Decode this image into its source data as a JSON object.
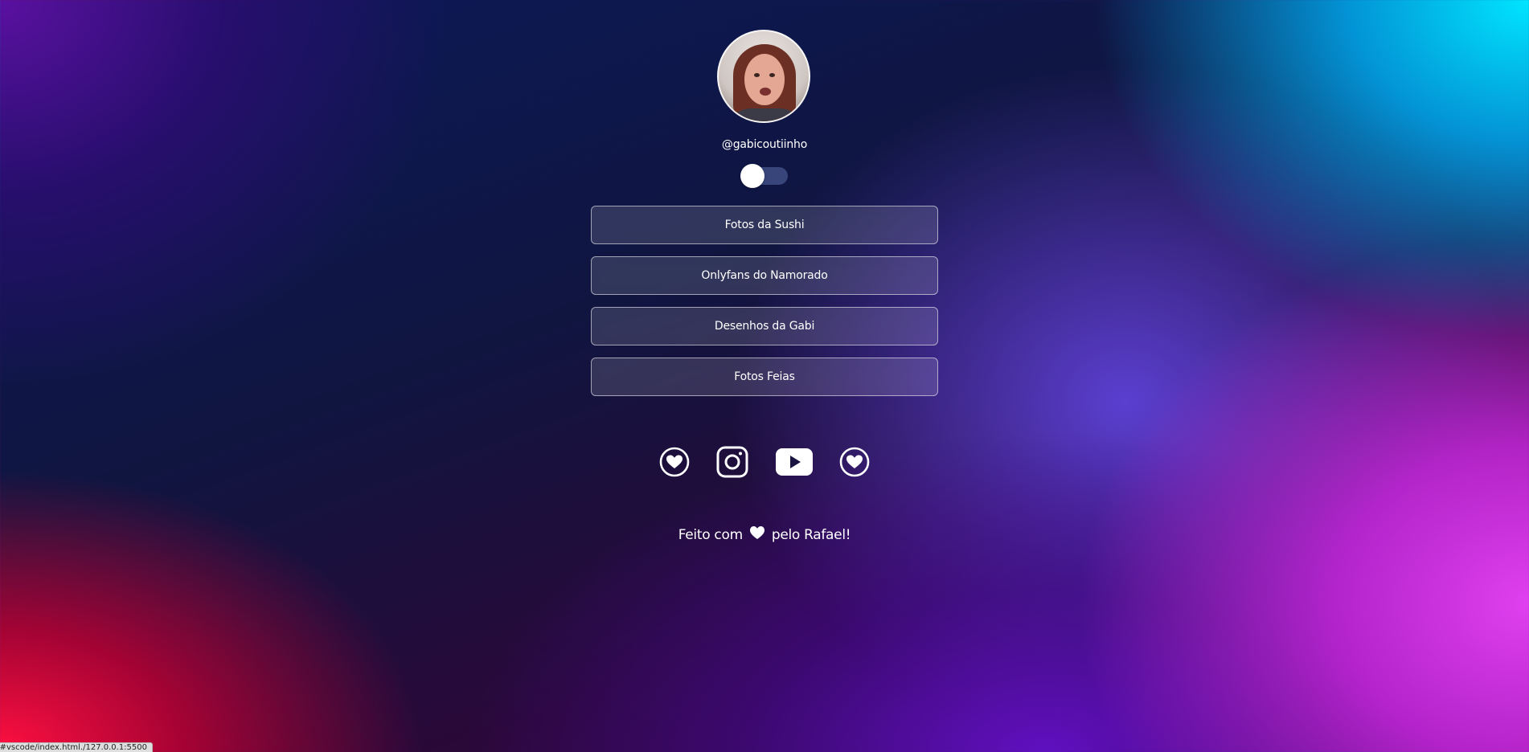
{
  "profile": {
    "handle": "@gabicoutiinho",
    "avatar_alt": "profile-photo"
  },
  "theme_toggle": {
    "state": "off"
  },
  "links": [
    {
      "label": "Fotos da Sushi"
    },
    {
      "label": "Onlyfans do Namorado"
    },
    {
      "label": "Desenhos da Gabi"
    },
    {
      "label": "Fotos Feias"
    }
  ],
  "socials": [
    {
      "icon": "heart-circle-icon"
    },
    {
      "icon": "instagram-icon"
    },
    {
      "icon": "youtube-icon"
    },
    {
      "icon": "heart-circle-icon"
    }
  ],
  "footer": {
    "prefix": "Feito com",
    "suffix": "pelo Rafael!",
    "icon": "heart-icon"
  },
  "status_bar": {
    "url": "127.0.0.1:5500/.vscode/index.html#"
  }
}
